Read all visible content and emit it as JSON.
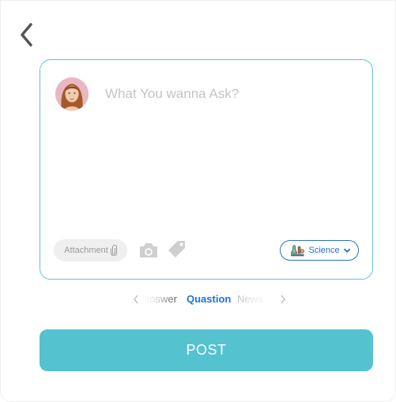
{
  "composer": {
    "placeholder": "What You wanna Ask?",
    "attachment_label": "Attachment",
    "subject": {
      "selected": "Science"
    }
  },
  "tabs": {
    "items": [
      {
        "label": "Answer",
        "active": false
      },
      {
        "label": "Quastion",
        "active": true
      },
      {
        "label": "News",
        "active": false
      }
    ]
  },
  "post_label": "POST",
  "colors": {
    "accent": "#55c2d0",
    "card_border": "#5ec4d1",
    "active_tab": "#1a73d9",
    "subject_blue": "#2a73c9"
  },
  "icons": {
    "back": "chevron-left-icon",
    "attachment": "paperclip-icon",
    "camera": "camera-icon",
    "tag": "tag-icon",
    "subject": "science-flask-icon",
    "subject_dropdown": "chevron-down-icon"
  }
}
